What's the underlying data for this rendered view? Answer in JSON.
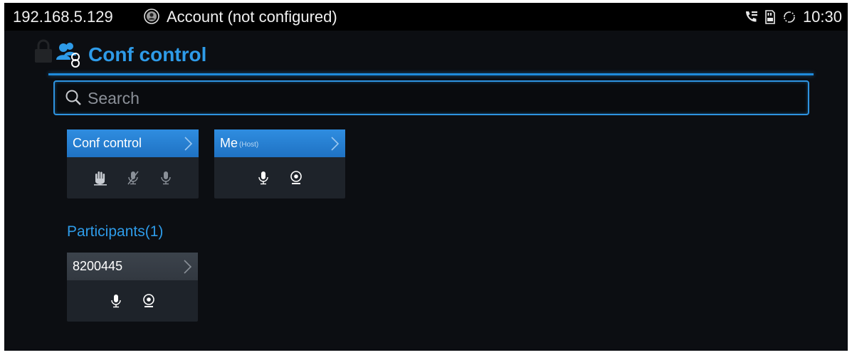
{
  "statusbar": {
    "ip": "192.168.5.129",
    "account": "Account (not configured)",
    "time": "10:30",
    "icons": [
      "account-icon",
      "call-forward-icon",
      "sd-card-icon",
      "sync-icon"
    ]
  },
  "header": {
    "title": "Conf control",
    "icon": "conference-icon",
    "accent": "#2e9be8"
  },
  "search": {
    "placeholder": "Search",
    "value": ""
  },
  "cards": {
    "conf_control": {
      "label": "Conf control",
      "icons": [
        "raise-hand-icon",
        "mute-all-icon",
        "unmute-all-icon"
      ]
    },
    "me": {
      "label": "Me",
      "sublabel": "(Host)",
      "icons": [
        "microphone-icon",
        "camera-icon"
      ]
    }
  },
  "participants": {
    "title": "Participants(1)",
    "items": [
      {
        "label": "8200445",
        "icons": [
          "microphone-icon",
          "camera-icon"
        ]
      }
    ]
  },
  "colors": {
    "background": "#0c0e12",
    "card_blue": "#2f8de0",
    "card_gray": "#3c434c",
    "card_body": "#1e232a"
  }
}
